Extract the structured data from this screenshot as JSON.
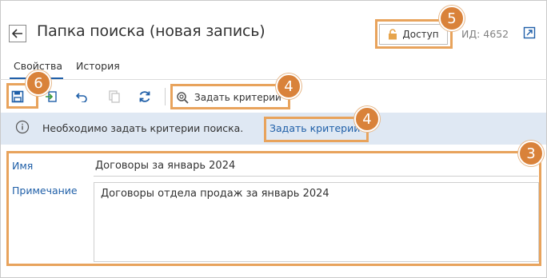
{
  "header": {
    "title": "Папка поиска (новая запись)",
    "access_label": "Доступ",
    "id_label": "ИД: 4652"
  },
  "tabs": [
    {
      "label": "Свойства"
    },
    {
      "label": "История"
    }
  ],
  "toolbar": {
    "criteria_label": "Задать критерии"
  },
  "info": {
    "text": "Необходимо задать критерии поиска.",
    "link": "Задать критерии"
  },
  "form": {
    "name_label": "Имя",
    "name_value": "Договоры за январь 2024",
    "note_label": "Примечание",
    "note_value": "Договоры отдела продаж за январь 2024"
  },
  "callouts": {
    "c3": "3",
    "c4a": "4",
    "c4b": "4",
    "c5": "5",
    "c6": "6"
  },
  "colors": {
    "accent": "#1f5fa8",
    "info_bg": "#dfe8f3",
    "callout": "#d9823a",
    "callout_border": "#e8a35c"
  }
}
